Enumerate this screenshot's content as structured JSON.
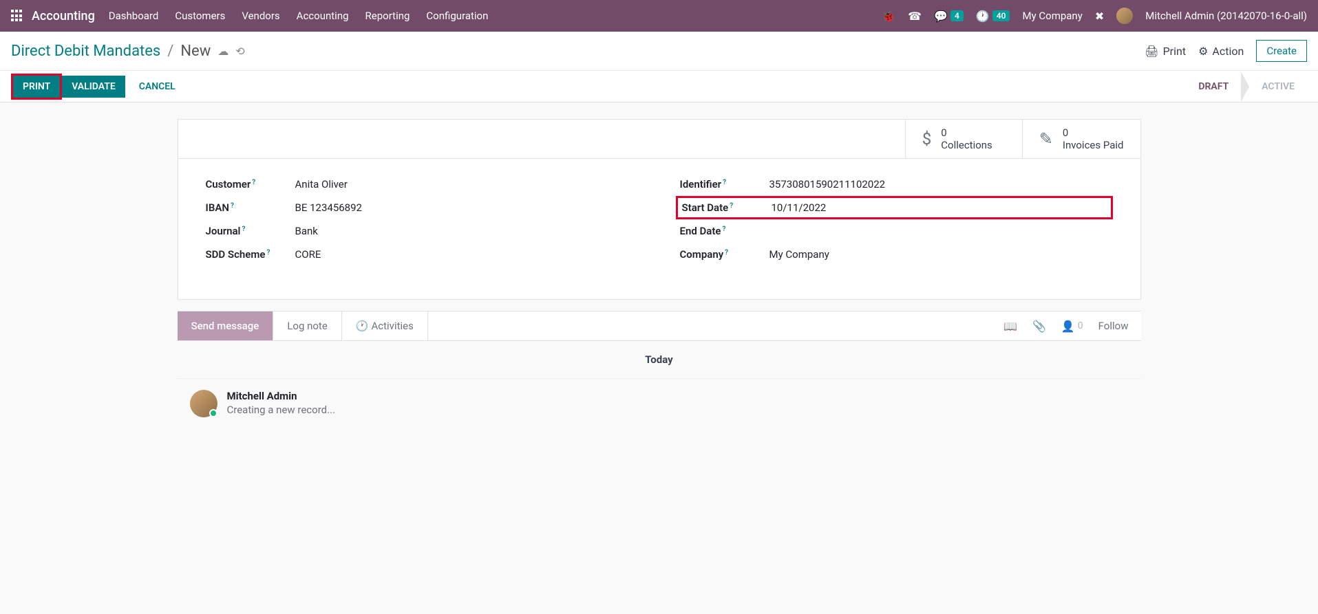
{
  "nav": {
    "brand": "Accounting",
    "items": [
      "Dashboard",
      "Customers",
      "Vendors",
      "Accounting",
      "Reporting",
      "Configuration"
    ],
    "chat_badge": "4",
    "clock_badge": "40",
    "company": "My Company",
    "user": "Mitchell Admin (20142070-16-0-all)"
  },
  "breadcrumb": {
    "parent": "Direct Debit Mandates",
    "current": "New"
  },
  "header_actions": {
    "print": "Print",
    "action": "Action",
    "create": "Create"
  },
  "buttons": {
    "print": "PRINT",
    "validate": "VALIDATE",
    "cancel": "CANCEL"
  },
  "status": {
    "draft": "DRAFT",
    "active": "ACTIVE"
  },
  "stats": {
    "collections_count": "0",
    "collections_label": "Collections",
    "invoices_count": "0",
    "invoices_label": "Invoices Paid"
  },
  "fields": {
    "customer_label": "Customer",
    "customer_value": "Anita Oliver",
    "iban_label": "IBAN",
    "iban_value": "BE 123456892",
    "journal_label": "Journal",
    "journal_value": "Bank",
    "scheme_label": "SDD Scheme",
    "scheme_value": "CORE",
    "identifier_label": "Identifier",
    "identifier_value": "35730801590211102022",
    "startdate_label": "Start Date",
    "startdate_value": "10/11/2022",
    "enddate_label": "End Date",
    "enddate_value": "",
    "company_label": "Company",
    "company_value": "My Company",
    "help": "?"
  },
  "chatter": {
    "send": "Send message",
    "lognote": "Log note",
    "activities": "Activities",
    "follower_count": "0",
    "follow": "Follow",
    "today": "Today",
    "author": "Mitchell Admin",
    "message": "Creating a new record..."
  }
}
